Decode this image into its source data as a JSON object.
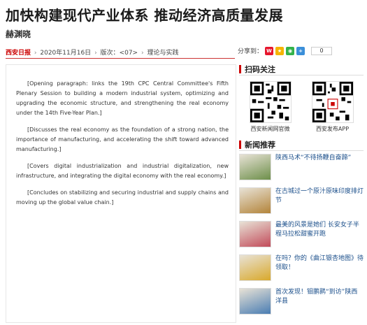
{
  "article": {
    "headline": "加快构建现代产业体系 推动经济高质量发展",
    "author": "赫渊晓",
    "source": "西安日报",
    "date": "2020年11月16日",
    "section_label": "版次：",
    "section_value": "<07>",
    "column": "理论与实践",
    "separator": "›",
    "paragraphs": [
      "[Opening paragraph: links the 19th CPC Central Committee's Fifth Plenary Session to building a modern industrial system, optimizing and upgrading the economic structure, and strengthening the real economy under the 14th Five-Year Plan.]",
      "[Discusses the real economy as the foundation of a strong nation, the importance of manufacturing, and accelerating the shift toward advanced manufacturing.]",
      "[Covers digital industrialization and industrial digitalization, new infrastructure, and integrating the digital economy with the real economy.]",
      "[Concludes on stabilizing and securing industrial and supply chains and moving up the global value chain.]"
    ]
  },
  "share": {
    "label": "分享到：",
    "count": "0",
    "icons": [
      "weibo-icon",
      "qzone-icon",
      "wechat-icon",
      "more-icon"
    ]
  },
  "sidebar": {
    "scan_title": "扫码关注",
    "qr": [
      {
        "caption": "西安新闻网官微"
      },
      {
        "caption": "西安发布APP"
      }
    ],
    "news_title": "新闻推荐",
    "news": [
      {
        "title": "陕西马术“不待扬鞭自奋蹄”",
        "thumb": "#6d8f4a"
      },
      {
        "title": "在古城过一个原汁原味印度排灯节",
        "thumb": "#b3843a"
      },
      {
        "title": "最美的风景是她们 长安女子半程马拉松甜蜜开跑",
        "thumb": "#c24b5a"
      },
      {
        "title": "在吗？你的《曲江银杏地图》待领取！",
        "thumb": "#d9a92c"
      },
      {
        "title": "首次发现！钼鹏鹮“到访”陕西洋县",
        "thumb": "#4a7db3"
      }
    ]
  },
  "colors": {
    "accent": "#cc0000",
    "link": "#1a4e8a"
  }
}
